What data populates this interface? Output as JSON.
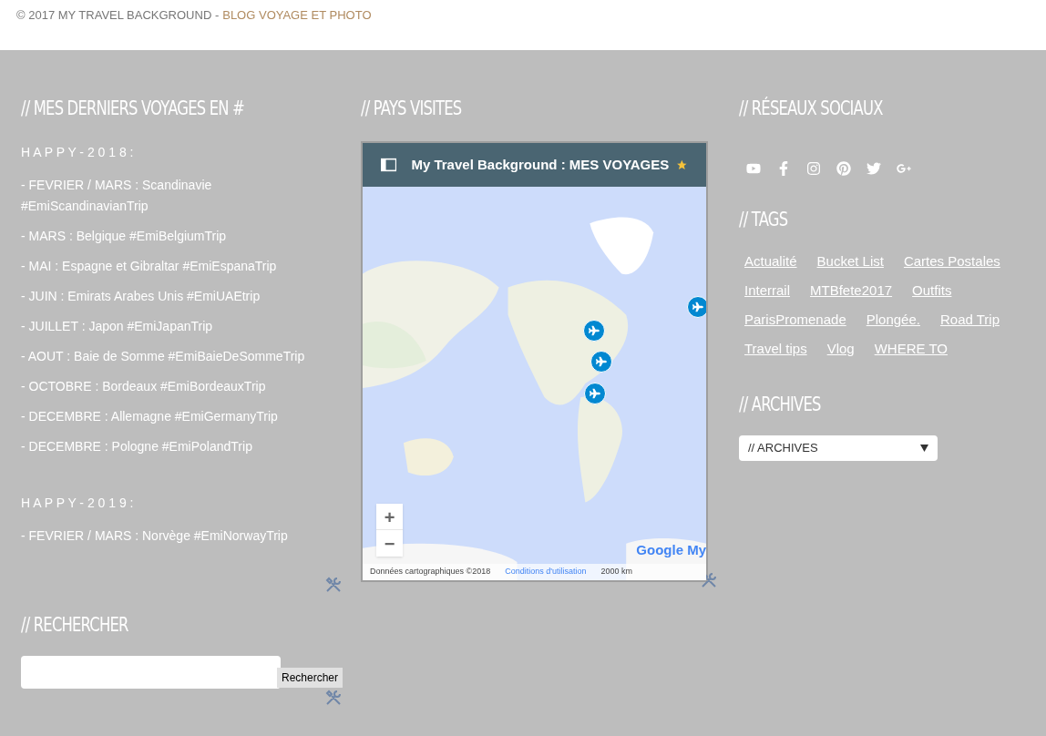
{
  "footer": {
    "copyright": "© 2017 MY TRAVEL BACKGROUND -",
    "link": "BLOG VOYAGE ET PHOTO"
  },
  "trips": {
    "title": "// MES DERNIERS VOYAGES EN #",
    "groups": [
      {
        "heading": "H A P P Y - 2 0 1 8 :",
        "items": [
          "- FEVRIER / MARS : Scandinavie #EmiScandinavianTrip",
          "- MARS : Belgique #EmiBelgiumTrip",
          "- MAI : Espagne et Gibraltar #EmiEspanaTrip",
          "- JUIN : Emirats Arabes Unis #EmiUAEtrip",
          "- JUILLET : Japon #EmiJapanTrip",
          "- AOUT : Baie de Somme #EmiBaieDeSommeTrip",
          "- OCTOBRE : Bordeaux #EmiBordeauxTrip",
          "- DECEMBRE : Allemagne #EmiGermanyTrip",
          "- DECEMBRE : Pologne #EmiPolandTrip"
        ]
      },
      {
        "heading": "H A P P Y - 2 0 1 9 :",
        "items": [
          "- FEVRIER / MARS : Norvège #EmiNorwayTrip"
        ]
      }
    ]
  },
  "search": {
    "title": "// RECHERCHER",
    "button": "Rechercher"
  },
  "map": {
    "title": "// PAYS VISITES",
    "header": "My Travel Background : MES VOYAGES",
    "zoom_in": "+",
    "zoom_out": "−",
    "logo": "Google My",
    "attribution": "Données cartographiques ©2018",
    "terms": "Conditions d'utilisation",
    "scale": "2000 km"
  },
  "social": {
    "title": "// RÉSEAUX SOCIAUX",
    "icons": [
      {
        "kind": "youtube"
      },
      {
        "kind": "facebook"
      },
      {
        "kind": "instagram"
      },
      {
        "kind": "pinterest"
      },
      {
        "kind": "twitter"
      },
      {
        "kind": "googleplus"
      }
    ]
  },
  "tags": {
    "title": "// TAGS",
    "items": [
      "Actualité",
      "Bucket List",
      "Cartes Postales",
      "Interrail",
      "MTBfete2017",
      "Outfits",
      "ParisPromenade",
      "Plongée.",
      "Road Trip",
      "Travel tips",
      "Vlog",
      "WHERE TO"
    ]
  },
  "archives": {
    "title": "// ARCHIVES",
    "select": "// ARCHIVES"
  }
}
